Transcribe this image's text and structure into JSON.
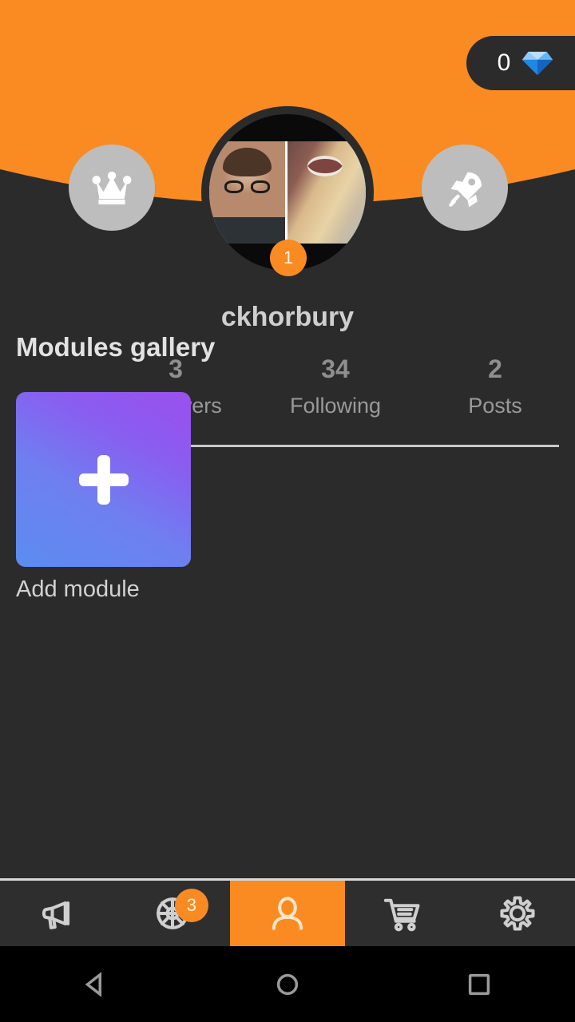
{
  "header": {
    "background_color": "#f98b22",
    "gem_counter": {
      "value": "0",
      "icon": "diamond-icon"
    },
    "left_action": {
      "icon": "crown-icon",
      "name": "crown-button"
    },
    "right_action": {
      "icon": "rocket-icon",
      "name": "rocket-button"
    }
  },
  "profile": {
    "username": "ckhorbury",
    "avatar_badge": "1",
    "avatar_icon": "profile-photo-collage",
    "stats": [
      {
        "value": "3",
        "label": "Followers"
      },
      {
        "value": "34",
        "label": "Following"
      },
      {
        "value": "2",
        "label": "Posts"
      }
    ]
  },
  "gallery": {
    "title": "Modules gallery",
    "add_tile": {
      "icon": "plus-icon",
      "label": "Add module"
    }
  },
  "tabbar": {
    "items": [
      {
        "name": "tab-promote",
        "icon": "megaphone-icon",
        "active": false,
        "badge": ""
      },
      {
        "name": "tab-wheel",
        "icon": "wheel-icon",
        "active": false,
        "badge": "3"
      },
      {
        "name": "tab-profile",
        "icon": "person-icon",
        "active": true,
        "badge": ""
      },
      {
        "name": "tab-shop",
        "icon": "cart-icon",
        "active": false,
        "badge": ""
      },
      {
        "name": "tab-settings",
        "icon": "gear-icon",
        "active": false,
        "badge": ""
      }
    ]
  },
  "system_nav": {
    "back": "back-triangle-icon",
    "home": "home-circle-icon",
    "recents": "recents-square-icon"
  },
  "colors": {
    "accent": "#f98b22",
    "background": "#2b2b2b",
    "tile_gradient_start": "#5b8def",
    "tile_gradient_end": "#9b50ee"
  }
}
